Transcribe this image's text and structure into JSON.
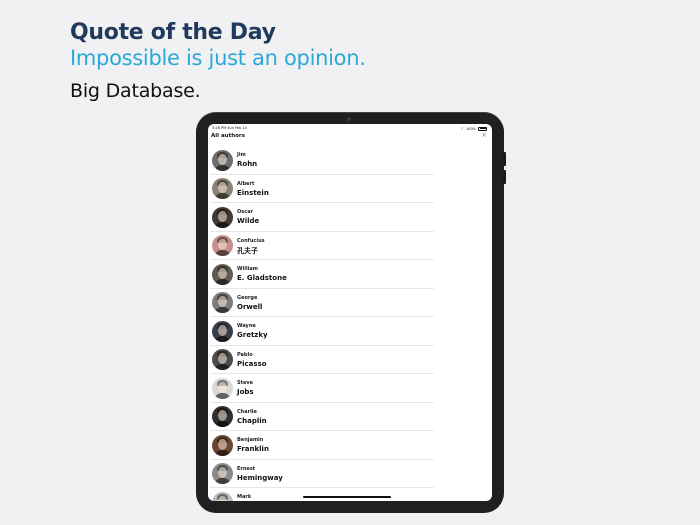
{
  "promo": {
    "title": "Quote of the Day",
    "subtitle": "Impossible is just an opinion.",
    "tagline": "Big Database."
  },
  "status_bar": {
    "time": "3:28 PM  Sun Feb 14",
    "battery": "100%"
  },
  "screen": {
    "nav_title": "All authors",
    "close_icon": "×"
  },
  "authors": [
    {
      "first": "Jim",
      "last": "Rohn",
      "avatar_color": "#6d6d6d"
    },
    {
      "first": "Albert",
      "last": "Einstein",
      "avatar_color": "#8a8275"
    },
    {
      "first": "Oscar",
      "last": "Wilde",
      "avatar_color": "#3e3a38"
    },
    {
      "first": "Confucius",
      "last": "孔夫子",
      "avatar_color": "#c48f8c"
    },
    {
      "first": "William",
      "last": "E. Gladstone",
      "avatar_color": "#5e5b55"
    },
    {
      "first": "George",
      "last": "Orwell",
      "avatar_color": "#7c7c7c"
    },
    {
      "first": "Wayne",
      "last": "Gretzky",
      "avatar_color": "#3a3f4c"
    },
    {
      "first": "Pablo",
      "last": "Picasso",
      "avatar_color": "#4b4b4b"
    },
    {
      "first": "Steve",
      "last": "Jobs",
      "avatar_color": "#d8d8d8"
    },
    {
      "first": "Charlie",
      "last": "Chaplin",
      "avatar_color": "#2f2f2f"
    },
    {
      "first": "Benjamin",
      "last": "Franklin",
      "avatar_color": "#6a4630"
    },
    {
      "first": "Ernest",
      "last": "Hemingway",
      "avatar_color": "#8a8a8a"
    },
    {
      "first": "Mark",
      "last": "",
      "avatar_color": "#bcbcbc"
    }
  ]
}
